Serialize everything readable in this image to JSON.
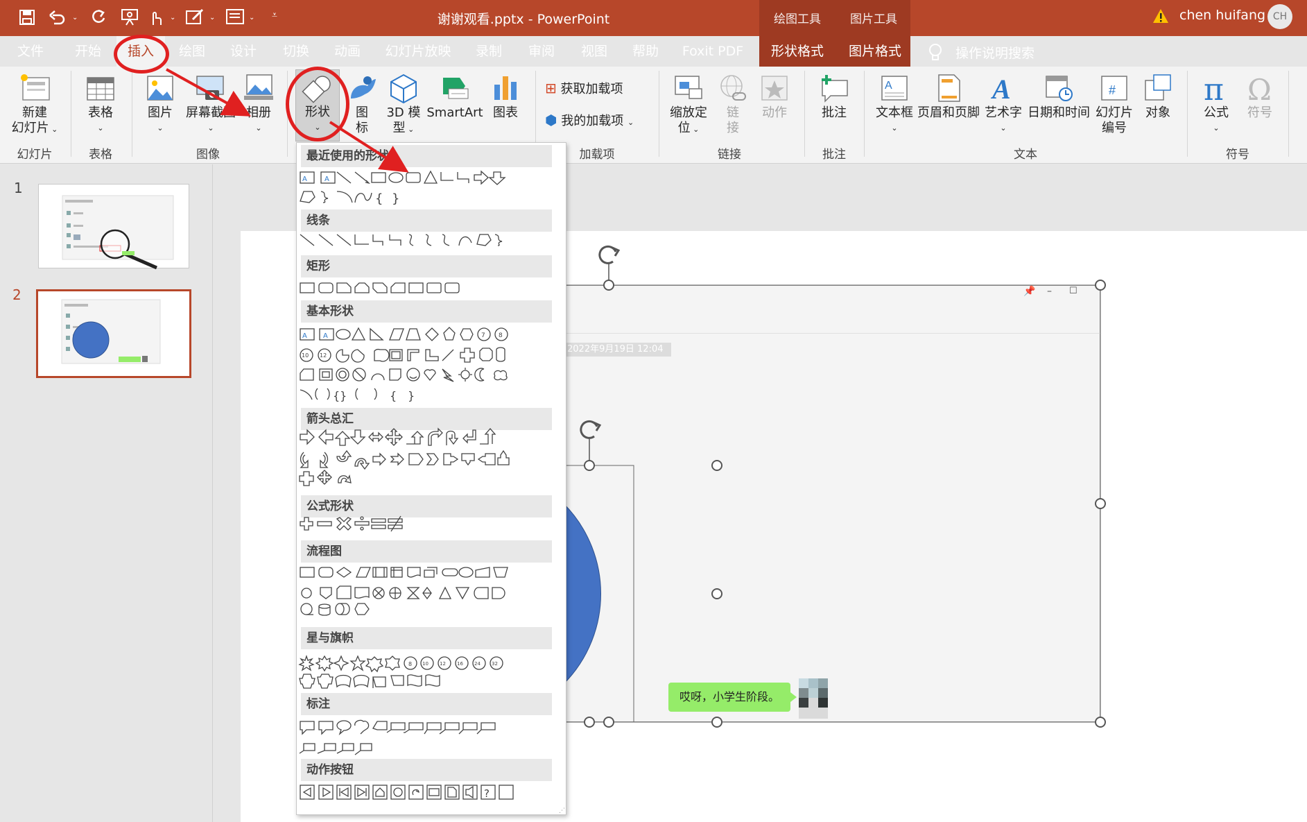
{
  "window": {
    "filename": "谢谢观看.pptx",
    "separator": "-",
    "app": "PowerPoint",
    "user": "chen huifang",
    "avatar": "CH",
    "context_tools": [
      "绘图工具",
      "图片工具"
    ]
  },
  "tabs": [
    "文件",
    "开始",
    "插入",
    "绘图",
    "设计",
    "切换",
    "动画",
    "幻灯片放映",
    "录制",
    "审阅",
    "视图",
    "帮助",
    "Foxit PDF",
    "形状格式",
    "图片格式"
  ],
  "active_tab": "插入",
  "search_label": "操作说明搜索",
  "ribbon": {
    "new_slide": [
      "新建",
      "幻灯片"
    ],
    "table": "表格",
    "picture": "图片",
    "screenshot": "屏幕截图",
    "album": "相册",
    "shapes": "形状",
    "icons": [
      "图",
      "标"
    ],
    "model3d": [
      "3D 模",
      "型"
    ],
    "smartart": "SmartArt",
    "chart": "图表",
    "get_addins": "获取加载项",
    "my_addins": "我的加载项",
    "zoom": [
      "缩放定",
      "位"
    ],
    "link": [
      "链",
      "接"
    ],
    "action": "动作",
    "comment": "批注",
    "textbox": "文本框",
    "header_footer": "页眉和页脚",
    "wordart": "艺术字",
    "datetime": "日期和时间",
    "slide_number": [
      "幻灯片",
      "编号"
    ],
    "object": "对象",
    "equation": "公式",
    "symbol": "符号",
    "groups": [
      "幻灯片",
      "表格",
      "图像",
      "加载项",
      "链接",
      "批注",
      "文本",
      "符号"
    ]
  },
  "slides": [
    "1",
    "2"
  ],
  "shapes_menu": {
    "sections": [
      "最近使用的形状",
      "线条",
      "矩形",
      "基本形状",
      "箭头总汇",
      "公式形状",
      "流程图",
      "星与旗帜",
      "标注",
      "动作按钮"
    ],
    "numbered": [
      "10",
      "12",
      "7",
      "8",
      "10",
      "12",
      "16",
      "24",
      "32"
    ]
  },
  "canvas": {
    "timestamp": "2022年9月19日 12:04",
    "chat_bubble": "哎呀，小学生阶段。",
    "window_controls": [
      "📌",
      "–",
      "☐"
    ]
  },
  "colors": {
    "accent": "#b7472a",
    "circle": "#4472c4",
    "bubble": "#95ec69",
    "highlight": "#e02020"
  }
}
